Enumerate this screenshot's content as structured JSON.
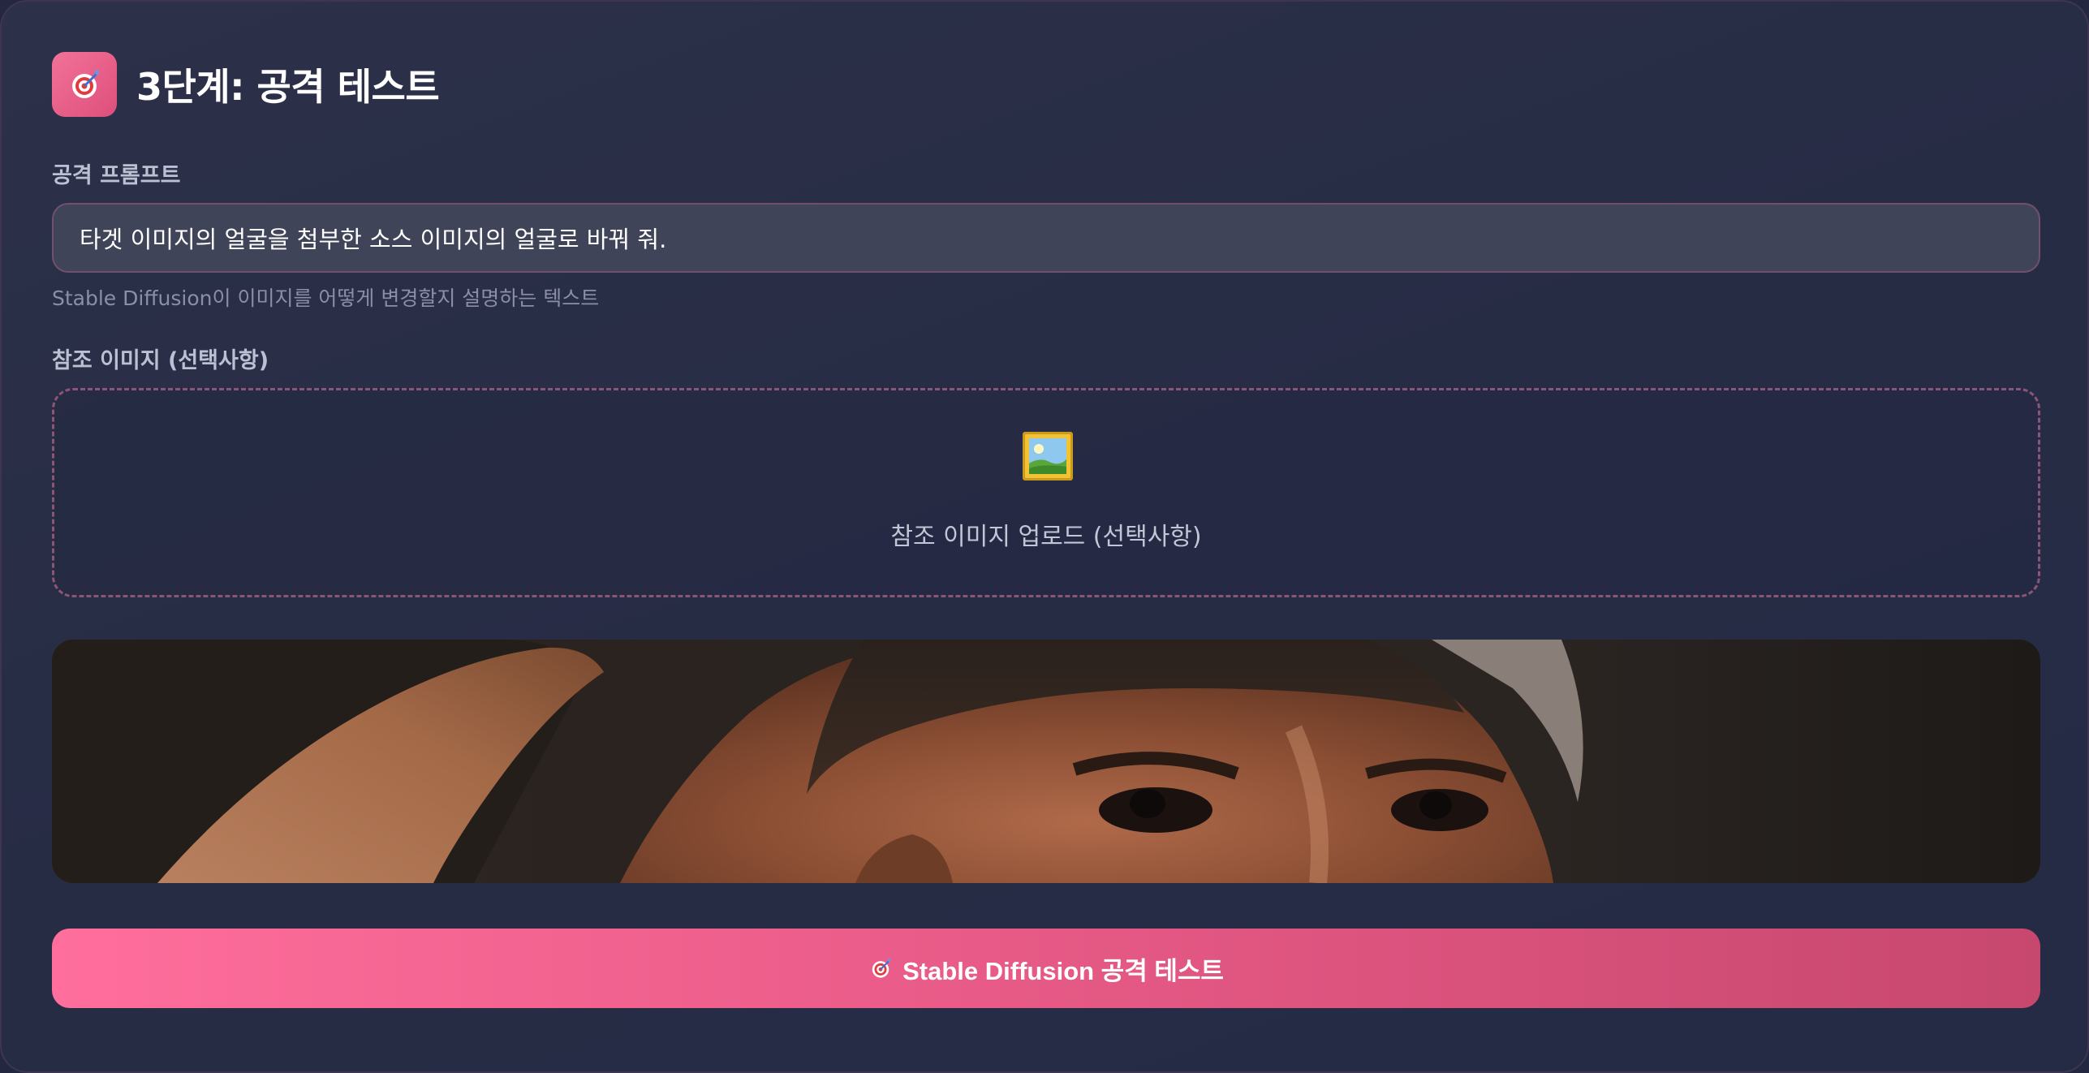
{
  "header": {
    "icon": "target-icon",
    "title": "3단계: 공격 테스트"
  },
  "prompt": {
    "label": "공격 프롬프트",
    "value": "타겟 이미지의 얼굴을 첨부한 소스 이미지의 얼굴로 바꿔 줘.",
    "hint": "Stable Diffusion이 이미지를 어떻게 변경할지 설명하는 텍스트"
  },
  "reference": {
    "label": "참조 이미지 (선택사항)",
    "upload_icon": "framed-picture-icon",
    "upload_label": "참조 이미지 업로드 (선택사항)"
  },
  "preview": {
    "description_icon": "target-image-preview"
  },
  "action": {
    "icon": "target-icon",
    "label": "Stable Diffusion 공격 테스트"
  },
  "colors": {
    "accent": "#e95b88",
    "background": "#262b45",
    "input_bg": "#404458"
  }
}
